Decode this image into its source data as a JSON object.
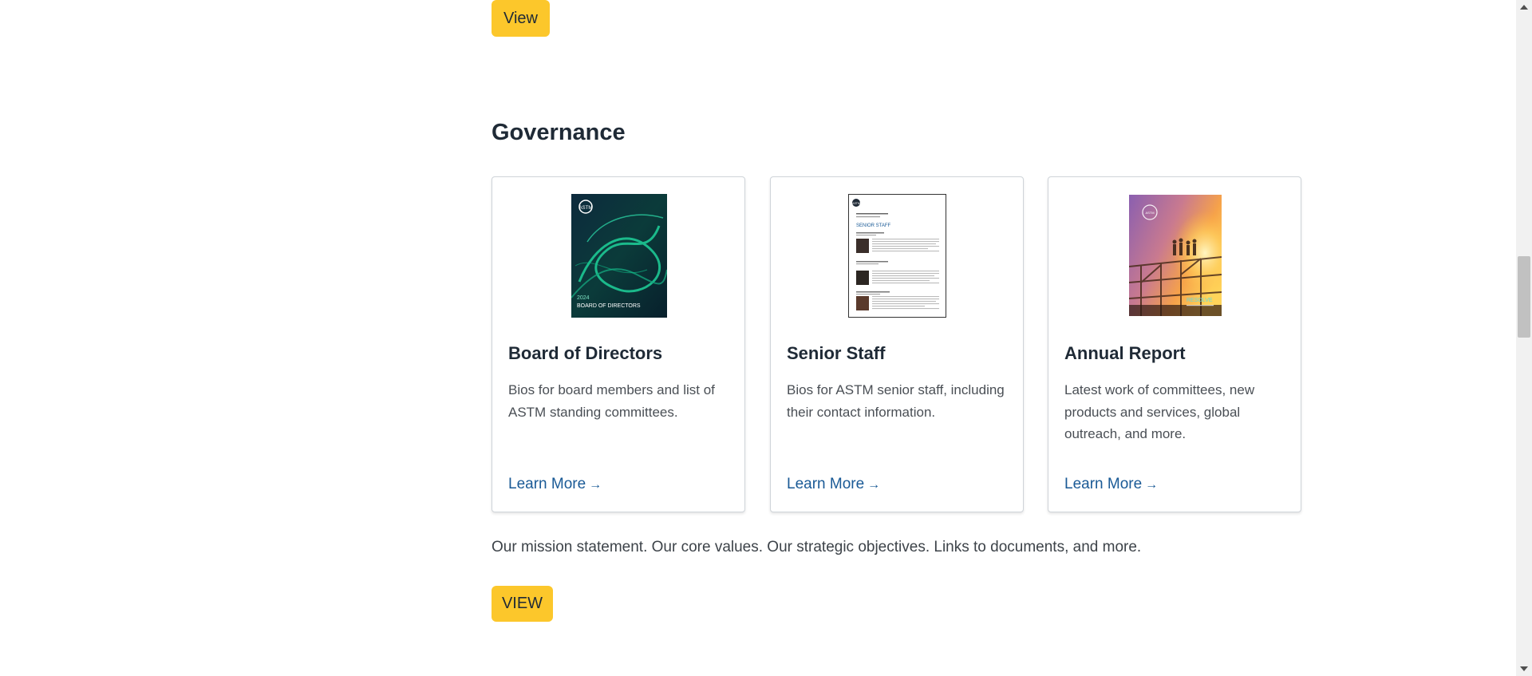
{
  "top_button": {
    "label": "View"
  },
  "governance": {
    "title": "Governance",
    "cards": [
      {
        "title": "Board of Directors",
        "description": "Bios for board members and list of ASTM standing committees.",
        "link": "Learn More",
        "cover_text": {
          "logo": "ASTM",
          "year": "2024",
          "caption": "BOARD OF DIRECTORS"
        }
      },
      {
        "title": "Senior Staff",
        "description": "Bios for ASTM senior staff, including their contact information.",
        "link": "Learn More",
        "cover_text": {
          "logo": "ASTM",
          "heading": "SENIOR STAFF"
        }
      },
      {
        "title": "Annual Report",
        "description": "Latest work of committees, new products and services, global outreach, and more.",
        "link": "Learn More",
        "cover_text": {
          "logo": "ASTM",
          "caption": "RESOLVE"
        }
      }
    ],
    "link_arrow": "→",
    "mission_text": "Our mission statement. Our core values. Our strategic objectives. Links to documents, and more.",
    "view_button": "VIEW"
  },
  "colors": {
    "accent_button": "#fcc72b",
    "link": "#1a5a96",
    "heading": "#1f2a36"
  }
}
